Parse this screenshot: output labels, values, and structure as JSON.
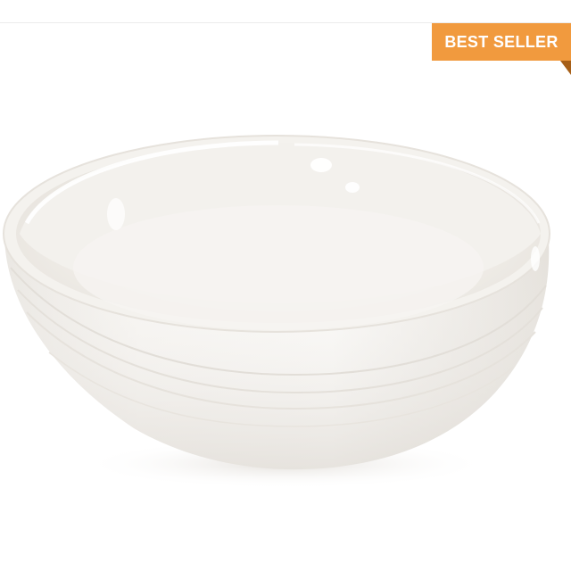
{
  "badge": {
    "label": "BEST SELLER",
    "color": "#f19a3e",
    "fold_color": "#a65f18"
  },
  "product": {
    "image_icon": "white-serving-bowl-image"
  }
}
